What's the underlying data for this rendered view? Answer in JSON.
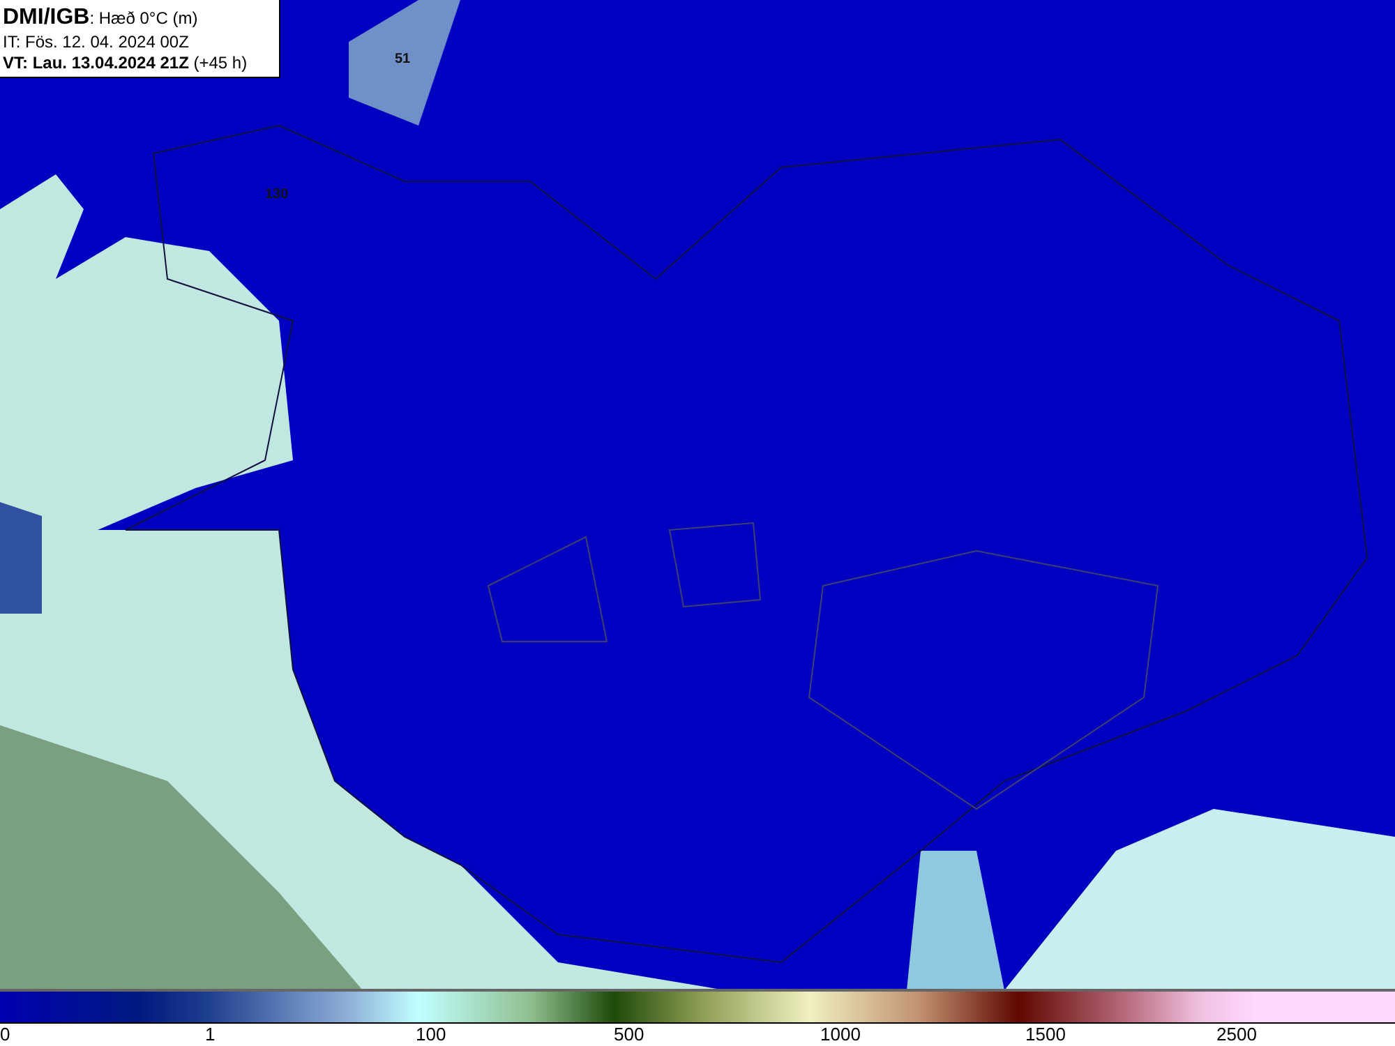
{
  "header": {
    "source": "DMI/IGB",
    "field": ": Hæð 0°C (m)",
    "init_time": "IT: Fös. 12. 04. 2024 00Z",
    "valid_time": "VT: Lau. 13.04.2024 21Z",
    "lead": " (+45 h)"
  },
  "map": {
    "labels": [
      "51",
      "130"
    ]
  },
  "colorbar": {
    "ticks": [
      "0",
      "1",
      "100",
      "500",
      "1000",
      "1500",
      "2500"
    ]
  }
}
